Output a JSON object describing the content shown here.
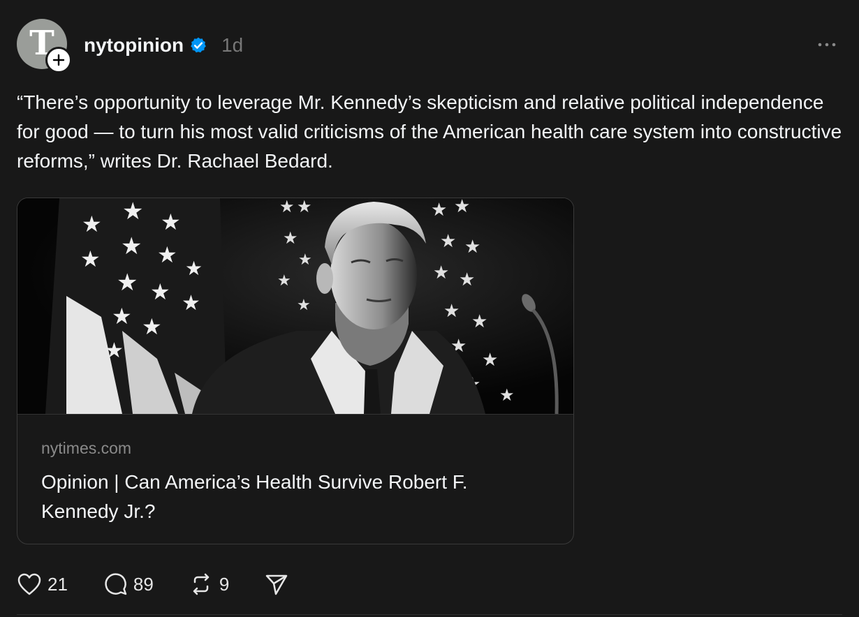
{
  "post": {
    "username": "nytopinion",
    "timestamp": "1d",
    "avatar_letter": "T",
    "text": "“There’s opportunity to leverage Mr. Kennedy’s skepticism and relative political independence for good — to turn his most valid criticisms of the American health care system into constructive reforms,” writes Dr. Rachael Bedard.",
    "verified": true
  },
  "link_card": {
    "domain": "nytimes.com",
    "title": "Opinion | Can America’s Health Survive Robert F. Kennedy Jr.?",
    "image": "black-and-white photo of a man in a suit in front of American flags"
  },
  "actions": {
    "likes": "21",
    "comments": "89",
    "reposts": "9"
  },
  "icons": {
    "more": "more-horizontal-icon",
    "like": "heart-icon",
    "comment": "comment-bubble-icon",
    "repost": "repost-icon",
    "share": "send-icon",
    "verified": "verified-badge-icon",
    "follow": "plus-icon"
  },
  "colors": {
    "background": "#181818",
    "verified": "#0095f6",
    "text": "#f3f5f7",
    "muted": "#777777"
  }
}
